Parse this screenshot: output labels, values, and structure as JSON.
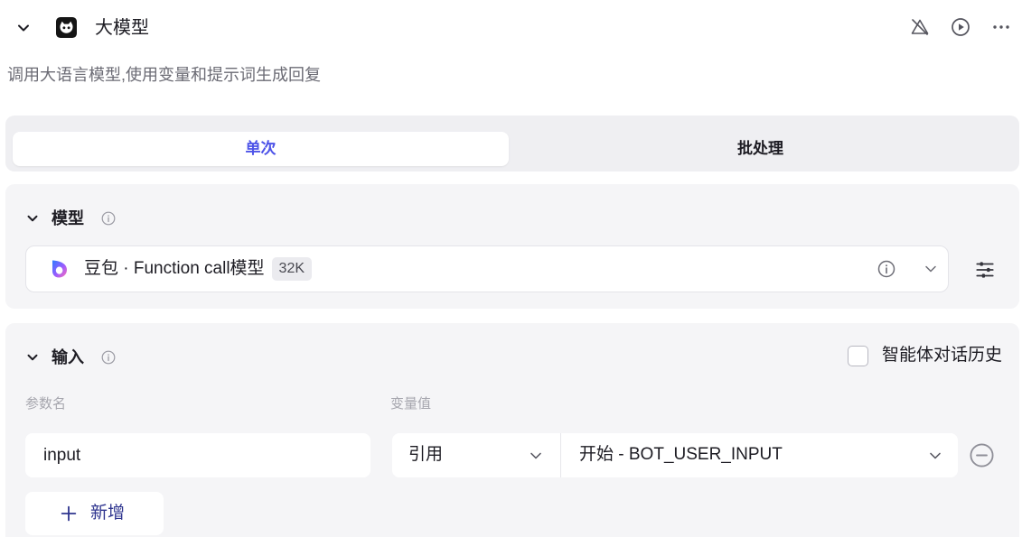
{
  "header": {
    "collapse_icon": "chevron-down-icon",
    "node_icon": "bot-avatar-icon",
    "title": "大模型",
    "action_icons": [
      "alert-off-icon",
      "play-circle-icon",
      "more-icon"
    ]
  },
  "description": "调用大语言模型,使用变量和提示词生成回复",
  "tabs": [
    {
      "label": "单次",
      "selected": true
    },
    {
      "label": "批处理",
      "selected": false
    }
  ],
  "model_section": {
    "title": "模型",
    "info_icon": "info-icon",
    "model": {
      "logo": "doubao-logo-icon",
      "name": "豆包 · Function call模型",
      "context_badge": "32K"
    },
    "settings_icon": "sliders-icon"
  },
  "input_section": {
    "title": "输入",
    "info_icon": "info-icon",
    "history_checkbox": {
      "label": "智能体对话历史",
      "checked": false
    },
    "columns": {
      "name": "参数名",
      "value": "变量值"
    },
    "rows": [
      {
        "name": "input",
        "value_type": "引用",
        "value": "开始 - BOT_USER_INPUT",
        "remove_icon": "minus-circle-icon"
      }
    ],
    "add_icon": "plus-icon",
    "add_label": "新增"
  },
  "colors": {
    "accent": "#4d53e8",
    "text": "#1d1c23",
    "muted_text": "#6b6b74",
    "card_background": "#f5f5f7"
  }
}
